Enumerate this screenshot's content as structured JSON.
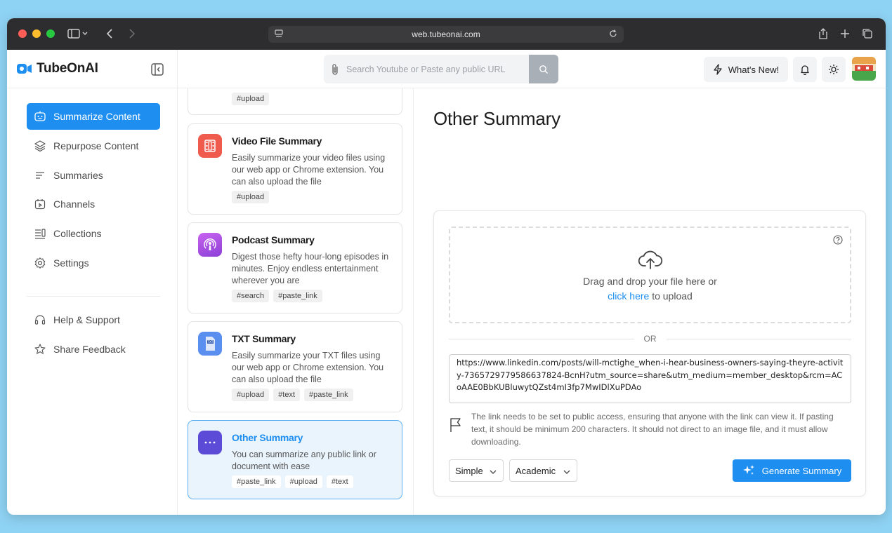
{
  "browser": {
    "url": "web.tubeonai.com"
  },
  "app": {
    "name": "TubeOnAI",
    "search_placeholder": "Search Youtube or Paste any public URL",
    "whats_new": "What's New!"
  },
  "sidebar": {
    "items": [
      {
        "label": "Summarize Content",
        "icon": "bot-icon",
        "active": true
      },
      {
        "label": "Repurpose Content",
        "icon": "layers-icon"
      },
      {
        "label": "Summaries",
        "icon": "lines-icon"
      },
      {
        "label": "Channels",
        "icon": "calendar-play-icon"
      },
      {
        "label": "Collections",
        "icon": "collection-icon"
      },
      {
        "label": "Settings",
        "icon": "gear-icon"
      }
    ],
    "secondary": [
      {
        "label": "Help & Support",
        "icon": "headset-icon"
      },
      {
        "label": "Share Feedback",
        "icon": "star-icon"
      }
    ]
  },
  "cards": [
    {
      "title": "",
      "desc": "",
      "tags": [
        "#upload"
      ]
    },
    {
      "title": "Video File Summary",
      "desc": "Easily summarize your video files using our web app or Chrome extension. You can also upload the file",
      "tags": [
        "#upload"
      ],
      "icon": "film-icon",
      "color": "#ef5b4c"
    },
    {
      "title": "Podcast Summary",
      "desc": "Digest those hefty hour-long episodes in minutes. Enjoy endless entertainment wherever you are",
      "tags": [
        "#search",
        "#paste_link"
      ],
      "icon": "podcast-icon",
      "color": "#b44be0"
    },
    {
      "title": "TXT Summary",
      "desc": "Easily summarize your TXT files using our web app or Chrome extension. You can also upload the file",
      "tags": [
        "#upload",
        "#text",
        "#paste_link"
      ],
      "icon": "txt-file-icon",
      "color": "#5a8ff0"
    },
    {
      "title": "Other Summary",
      "desc": "You can summarize any public link or document with ease",
      "tags": [
        "#paste_link",
        "#upload",
        "#text"
      ],
      "icon": "dots-icon",
      "color": "#5b4bd6"
    }
  ],
  "main": {
    "title": "Other Summary",
    "drop_text": "Drag and drop your file here or",
    "drop_link": "click here",
    "drop_suffix": "to upload",
    "or_label": "OR",
    "url_value": "https://www.linkedin.com/posts/will-mctighe_when-i-hear-business-owners-saying-theyre-activity-7365729779586637824-BcnH?utm_source=share&utm_medium=member_desktop&rcm=ACoAAE0BbKUBluwytQZst4mI3fp7MwIDlXuPDAo",
    "note": "The link needs to be set to public access, ensuring that anyone with the link can view it. If pasting text, it should be minimum 200 characters. It should not direct to an image file, and it must allow downloading.",
    "length_option": "Simple",
    "style_option": "Academic",
    "generate_label": "Generate Summary"
  },
  "colors": {
    "accent": "#1e8ef0",
    "active_card_bg": "#eaf4fd"
  }
}
